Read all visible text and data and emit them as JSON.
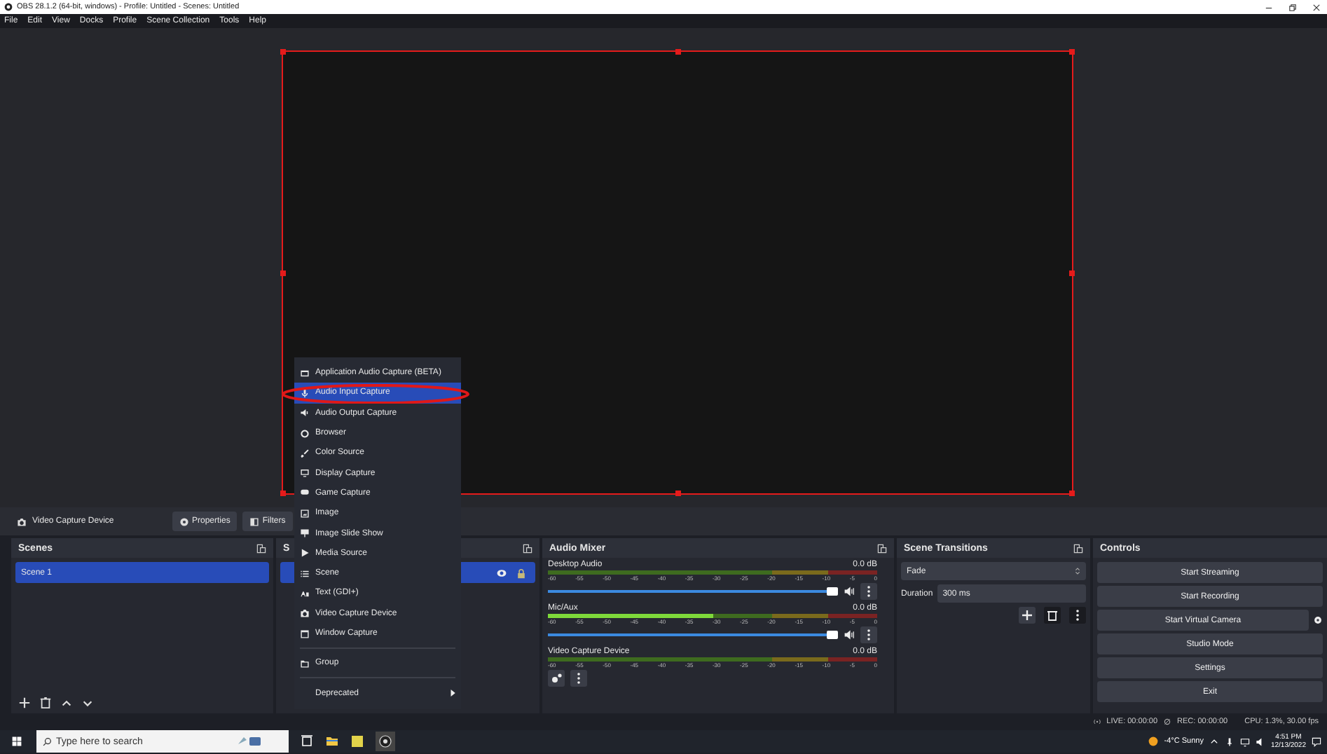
{
  "window": {
    "title": "OBS 28.1.2 (64-bit, windows) - Profile: Untitled - Scenes: Untitled"
  },
  "menu": [
    "File",
    "Edit",
    "View",
    "Docks",
    "Profile",
    "Scene Collection",
    "Tools",
    "Help"
  ],
  "source_toolbar": {
    "source": "Video Capture Device",
    "buttons": [
      "Properties",
      "Filters"
    ]
  },
  "context_menu": {
    "items": [
      {
        "kind": "item",
        "label": "Application Audio Capture (BETA)",
        "selected": false
      },
      {
        "kind": "item",
        "label": "Audio Input Capture",
        "selected": true
      },
      {
        "kind": "item",
        "label": "Audio Output Capture",
        "selected": false
      },
      {
        "kind": "item",
        "label": "Browser",
        "selected": false
      },
      {
        "kind": "item",
        "label": "Color Source",
        "selected": false
      },
      {
        "kind": "item",
        "label": "Display Capture",
        "selected": false
      },
      {
        "kind": "item",
        "label": "Game Capture",
        "selected": false
      },
      {
        "kind": "item",
        "label": "Image",
        "selected": false
      },
      {
        "kind": "item",
        "label": "Image Slide Show",
        "selected": false
      },
      {
        "kind": "item",
        "label": "Media Source",
        "selected": false
      },
      {
        "kind": "item",
        "label": "Scene",
        "selected": false
      },
      {
        "kind": "item",
        "label": "Text (GDI+)",
        "selected": false
      },
      {
        "kind": "item",
        "label": "Video Capture Device",
        "selected": false
      },
      {
        "kind": "item",
        "label": "Window Capture",
        "selected": false
      },
      {
        "kind": "separator"
      },
      {
        "kind": "item",
        "label": "Group",
        "selected": false
      },
      {
        "kind": "separator"
      },
      {
        "kind": "submenu",
        "label": "Deprecated",
        "selected": false
      }
    ]
  },
  "scenes": {
    "title": "Scenes",
    "items": [
      {
        "label": "Scene 1",
        "selected": true
      }
    ]
  },
  "sources": {
    "title": "S",
    "items": [
      {
        "selected": true
      }
    ]
  },
  "audio_mixer": {
    "title": "Audio Mixer",
    "channels": [
      {
        "kind": "full",
        "name": "Desktop Audio",
        "reading": "0.0 dB",
        "meter": {
          "level": 0
        },
        "volume": {
          "level": 1
        },
        "scale": [
          "-60",
          "-55",
          "-50",
          "-45",
          "-40",
          "-35",
          "-30",
          "-25",
          "-20",
          "-15",
          "-10",
          "-5",
          "0"
        ]
      },
      {
        "kind": "full",
        "name": "Mic/Aux",
        "reading": "0.0 dB",
        "meter": {
          "level": 0.5
        },
        "volume": {
          "level": 1
        },
        "scale": [
          "-60",
          "-55",
          "-50",
          "-45",
          "-40",
          "-35",
          "-30",
          "-25",
          "-20",
          "-15",
          "-10",
          "-5",
          "0"
        ]
      },
      {
        "kind": "compact",
        "name": "Video Capture Device",
        "reading": "0.0 dB",
        "meter": {
          "level": 0
        },
        "scale": [
          "-60",
          "-55",
          "-50",
          "-45",
          "-40",
          "-35",
          "-30",
          "-25",
          "-20",
          "-15",
          "-10",
          "-5",
          "0"
        ]
      }
    ]
  },
  "scene_transitions": {
    "title": "Scene Transitions",
    "transition": "Fade",
    "duration_label": "Duration",
    "duration": "300 ms"
  },
  "controls": {
    "title": "Controls",
    "buttons": [
      "Start Streaming",
      "Start Recording",
      "Start Virtual Camera",
      "Studio Mode",
      "Settings",
      "Exit"
    ]
  },
  "status_bar": {
    "live": "LIVE: 00:00:00",
    "rec": "REC: 00:00:00",
    "cpu": "CPU: 1.3%, 30.00 fps"
  },
  "taskbar": {
    "search": {
      "placeholder": "Type here to search"
    },
    "weather": "-4°C Sunny",
    "time": "4:51 PM",
    "date": "12/13/2022"
  }
}
